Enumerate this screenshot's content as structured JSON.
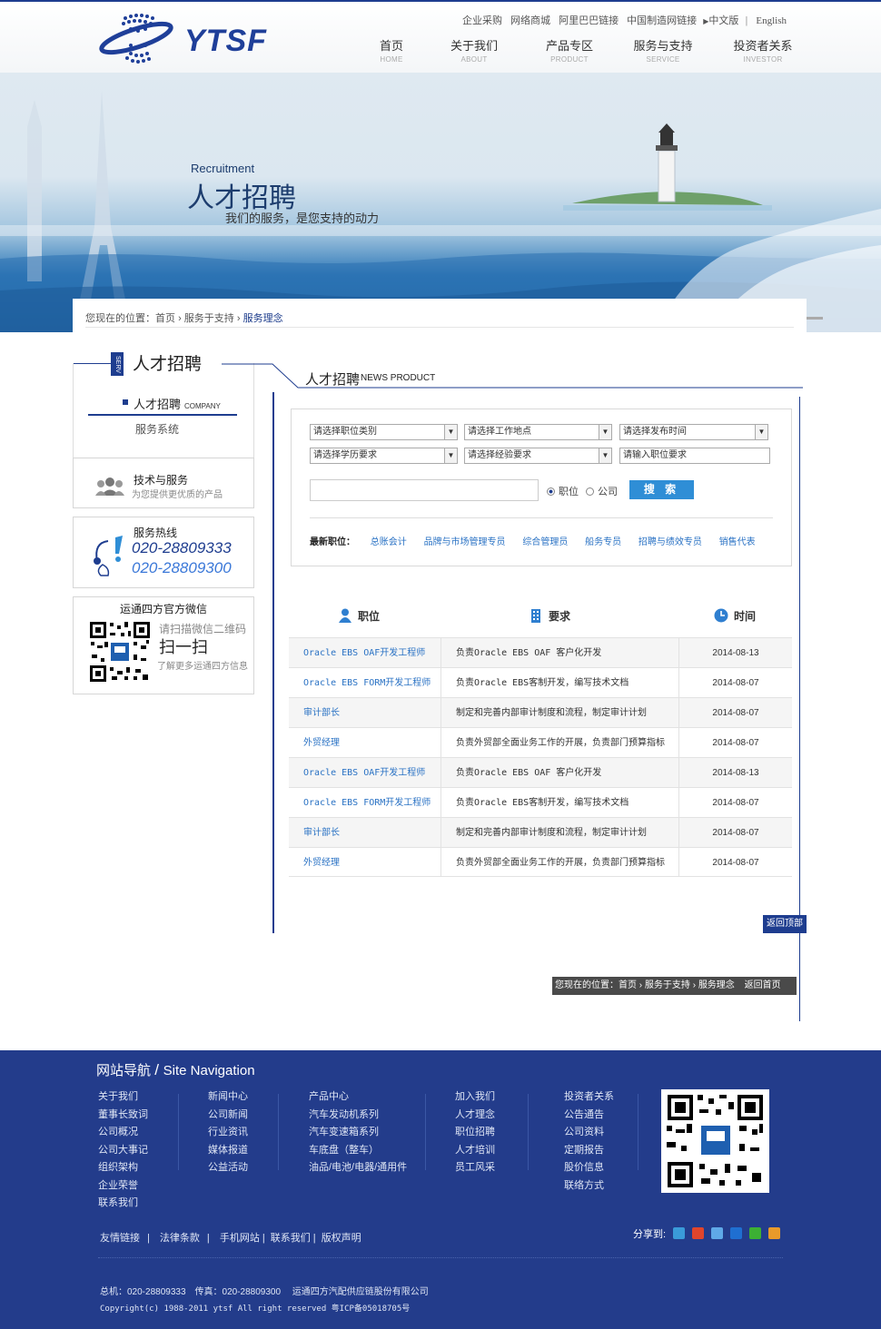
{
  "header": {
    "logo_text": "YTSF",
    "top_links": [
      "企业采购",
      "网络商城",
      "阿里巴巴链接",
      "中国制造网链接",
      "中文版",
      "English"
    ],
    "nav": [
      {
        "cn": "首页",
        "en": "HOME"
      },
      {
        "cn": "关于我们",
        "en": "ABOUT"
      },
      {
        "cn": "产品专区",
        "en": "PRODUCT"
      },
      {
        "cn": "服务与支持",
        "en": "SERVICE"
      },
      {
        "cn": "投资者关系",
        "en": "INVESTOR"
      }
    ]
  },
  "banner": {
    "en_title": "Recruitment",
    "cn_title": "人才招聘",
    "subtitle": "我们的服务，是您支持的动力"
  },
  "breadcrumb": {
    "prefix": "您现在的位置：",
    "items": [
      "首页",
      "服务于支持",
      "服务理念"
    ]
  },
  "sidebar": {
    "tag": "SERV",
    "title": "人才招聘",
    "active_item": "人才招聘",
    "active_item_en": "COMPANY",
    "sub_item": "服务系统",
    "tech_title": "技术与服务",
    "tech_desc": "为您提供更优质的产品",
    "hotline_title": "服务热线",
    "hotline_1": "020-28809333",
    "hotline_2": "020-28809300",
    "wechat_title": "运通四方官方微信",
    "wechat_line1": "请扫描微信二维码",
    "wechat_line2": "扫一扫",
    "wechat_line3": "了解更多运通四方信息"
  },
  "content": {
    "title_cn": "人才招聘",
    "title_en": "NEWS PRODUCT",
    "search": {
      "selects": [
        "请选择职位类别",
        "请选择工作地点",
        "请选择发布时间",
        "请选择学历要求",
        "请选择经验要求"
      ],
      "position_req_value": "请输入职位要求",
      "keyword_value": "",
      "radio_position": "职位",
      "radio_company": "公司",
      "button": "搜 索",
      "latest_label": "最新职位：",
      "latest_jobs": [
        "总账会计",
        "品牌与市场管理专员",
        "综合管理员",
        "船务专员",
        "招聘与绩效专员",
        "销售代表"
      ]
    },
    "table": {
      "headers": [
        "职位",
        "要求",
        "时间"
      ],
      "rows": [
        {
          "position": "Oracle EBS OAF开发工程师",
          "requirement": "负责Oracle EBS OAF 客户化开发",
          "date": "2014-08-13"
        },
        {
          "position": "Oracle EBS FORM开发工程师",
          "requirement": "负责Oracle EBS客制开发，编写技术文档",
          "date": "2014-08-07"
        },
        {
          "position": "审计部长",
          "requirement": "制定和完善内部审计制度和流程，制定审计计划",
          "date": "2014-08-07"
        },
        {
          "position": "外贸经理",
          "requirement": "负责外贸部全面业务工作的开展，负责部门预算指标",
          "date": "2014-08-07"
        },
        {
          "position": "Oracle EBS OAF开发工程师",
          "requirement": "负责Oracle EBS OAF 客户化开发",
          "date": "2014-08-13"
        },
        {
          "position": "Oracle EBS FORM开发工程师",
          "requirement": "负责Oracle EBS客制开发，编写技术文档",
          "date": "2014-08-07"
        },
        {
          "position": "审计部长",
          "requirement": "制定和完善内部审计制度和流程，制定审计计划",
          "date": "2014-08-07"
        },
        {
          "position": "外贸经理",
          "requirement": "负责外贸部全面业务工作的开展，负责部门预算指标",
          "date": "2014-08-07"
        }
      ]
    },
    "back_to_top": "返回顶部",
    "bottom_crumb": {
      "prefix": "您现在的位置：",
      "items": [
        "首页",
        "服务于支持",
        "服务理念"
      ],
      "home_link": "返回首页"
    }
  },
  "footer": {
    "title_cn": "网站导航",
    "title_en": "Site Navigation",
    "columns": [
      [
        "关于我们",
        "董事长致词",
        "公司概况",
        "公司大事记",
        "组织架构",
        "企业荣誉",
        "联系我们"
      ],
      [
        "新闻中心",
        "公司新闻",
        "行业资讯",
        "媒体报道",
        "公益活动"
      ],
      [
        "产品中心",
        "汽车发动机系列",
        "汽车变速箱系列",
        "车底盘（整车）",
        "油品/电池/电器/通用件"
      ],
      [
        "加入我们",
        "人才理念",
        "职位招聘",
        "人才培训",
        "员工风采"
      ],
      [
        "投资者关系",
        "公告通告",
        "公司资料",
        "定期报告",
        "股价信息",
        "联络方式"
      ]
    ],
    "bottom_links": [
      "友情链接",
      "法律条款",
      "手机网站",
      "联系我们",
      "版权声明"
    ],
    "share_label": "分享到:",
    "info": "总机：020-28809333　传真：020-28809300　 运通四方汽配供应链股份有限公司",
    "copyright": "Copyright(c) 1988-2011 ytsf All right reserved 粤ICP备05018705号",
    "colors": {
      "background": "#233c8b",
      "accent": "#1e3d8f",
      "link": "#2a72c4"
    }
  }
}
